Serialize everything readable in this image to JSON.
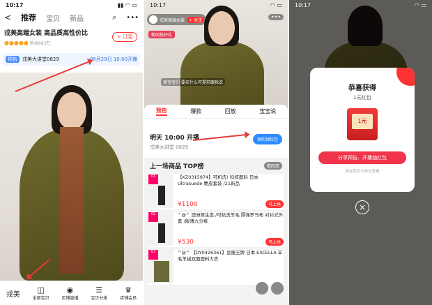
{
  "status": {
    "time": "10:17"
  },
  "p1": {
    "nav": {
      "back": "<",
      "tab_active": "推荐",
      "tab2": "宝贝",
      "tab3": "新品"
    },
    "shop": {
      "title": "戎美高端女装 高品质高性价比",
      "fans": "粉丝883万",
      "follow": "+ 订阅"
    },
    "notice": {
      "badge": "预告",
      "host": "戎美大讲堂0829",
      "time": "08月29日 10:00开播"
    },
    "bottom": [
      {
        "label": "戎美",
        "icon": "logo"
      },
      {
        "label": "全部宝贝",
        "icon": "bag-icon"
      },
      {
        "label": "店铺直播",
        "icon": "live-icon"
      },
      {
        "label": "宝贝分类",
        "icon": "list-icon"
      },
      {
        "label": "店铺会员",
        "icon": "crown-icon"
      }
    ]
  },
  "p2": {
    "anchor": {
      "name": "戎美高端女装",
      "follow": "+ 关注",
      "more": "•••"
    },
    "pill": "新闻抢好礼",
    "comment1": "美宝宝们",
    "comment2": "要买什么可提前跟我说",
    "tabs": [
      "预告",
      "爆款",
      "回放",
      "宝宝说"
    ],
    "live": {
      "title": "明天 10:00 开播",
      "sub": "戎美大讲堂 0829",
      "remind": "预约领红包"
    },
    "top": {
      "title": "上一场商品 TOP榜",
      "view": "看回放"
    },
    "products": [
      {
        "rank": "01",
        "name": "【KZ0315974】可机洗! 科技面料 日本 Ultrasuede 麂皮套装 /21新品",
        "price": "1100",
        "btn": "马上抢"
      },
      {
        "rank": "02",
        "name": "^@^ 澳洲原生态 /可机洗羊毛 厚弹罗马布 衬衫式外套 /版薄九分裤",
        "price": "530",
        "btn": "马上抢"
      },
      {
        "rank": "03",
        "name": "^@^ 【DY0426361】显瘦王牌 日本 EXCELLA 羊毛羊绒双面面料大衣",
        "price": "",
        "btn": "马上抢"
      }
    ],
    "actions": [
      "分享",
      "转发"
    ]
  },
  "p3": {
    "modal": {
      "title": "恭喜获得",
      "sub": "1元红包",
      "coupon": "1元",
      "btn": "分享预告、开播抽红包",
      "note": "请在我的卡券包查看",
      "close": "×"
    }
  }
}
